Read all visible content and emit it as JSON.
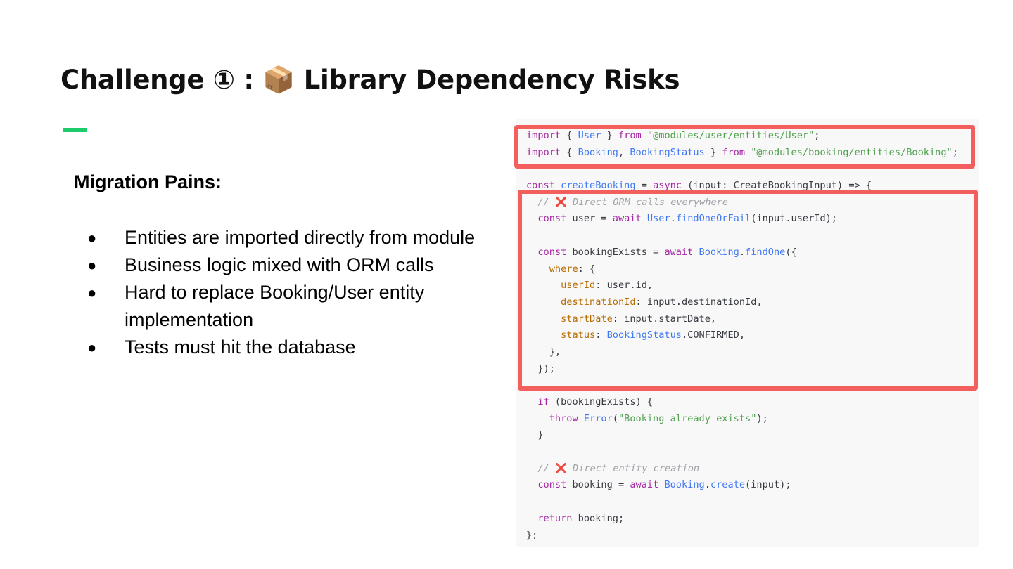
{
  "slide": {
    "title": "Challenge ① : 📦 Library Dependency Risks",
    "accent_color": "#1ecb6b",
    "subheading": "Migration Pains:",
    "bullets": [
      "Entities are imported directly from module",
      "Business logic mixed with ORM calls",
      "Hard to replace Booking/User entity implementation",
      "Tests must hit the database"
    ],
    "bullet_glyph": "●"
  },
  "code": {
    "highlight_color": "#f25f5c",
    "lines": [
      "import { User } from \"@modules/user/entities/User\";",
      "import { Booking, BookingStatus } from \"@modules/booking/entities/Booking\";",
      "",
      "const createBooking = async (input: CreateBookingInput) => {",
      "  // ❌ Direct ORM calls everywhere",
      "  const user = await User.findOneOrFail(input.userId);",
      "",
      "  const bookingExists = await Booking.findOne({",
      "    where: {",
      "      userId: user.id,",
      "      destinationId: input.destinationId,",
      "      startDate: input.startDate,",
      "      status: BookingStatus.CONFIRMED,",
      "    },",
      "  });",
      "",
      "  if (bookingExists) {",
      "    throw Error(\"Booking already exists\");",
      "  }",
      "",
      "  // ❌ Direct entity creation",
      "  const booking = await Booking.create(input);",
      "",
      "  return booking;",
      "};"
    ]
  }
}
